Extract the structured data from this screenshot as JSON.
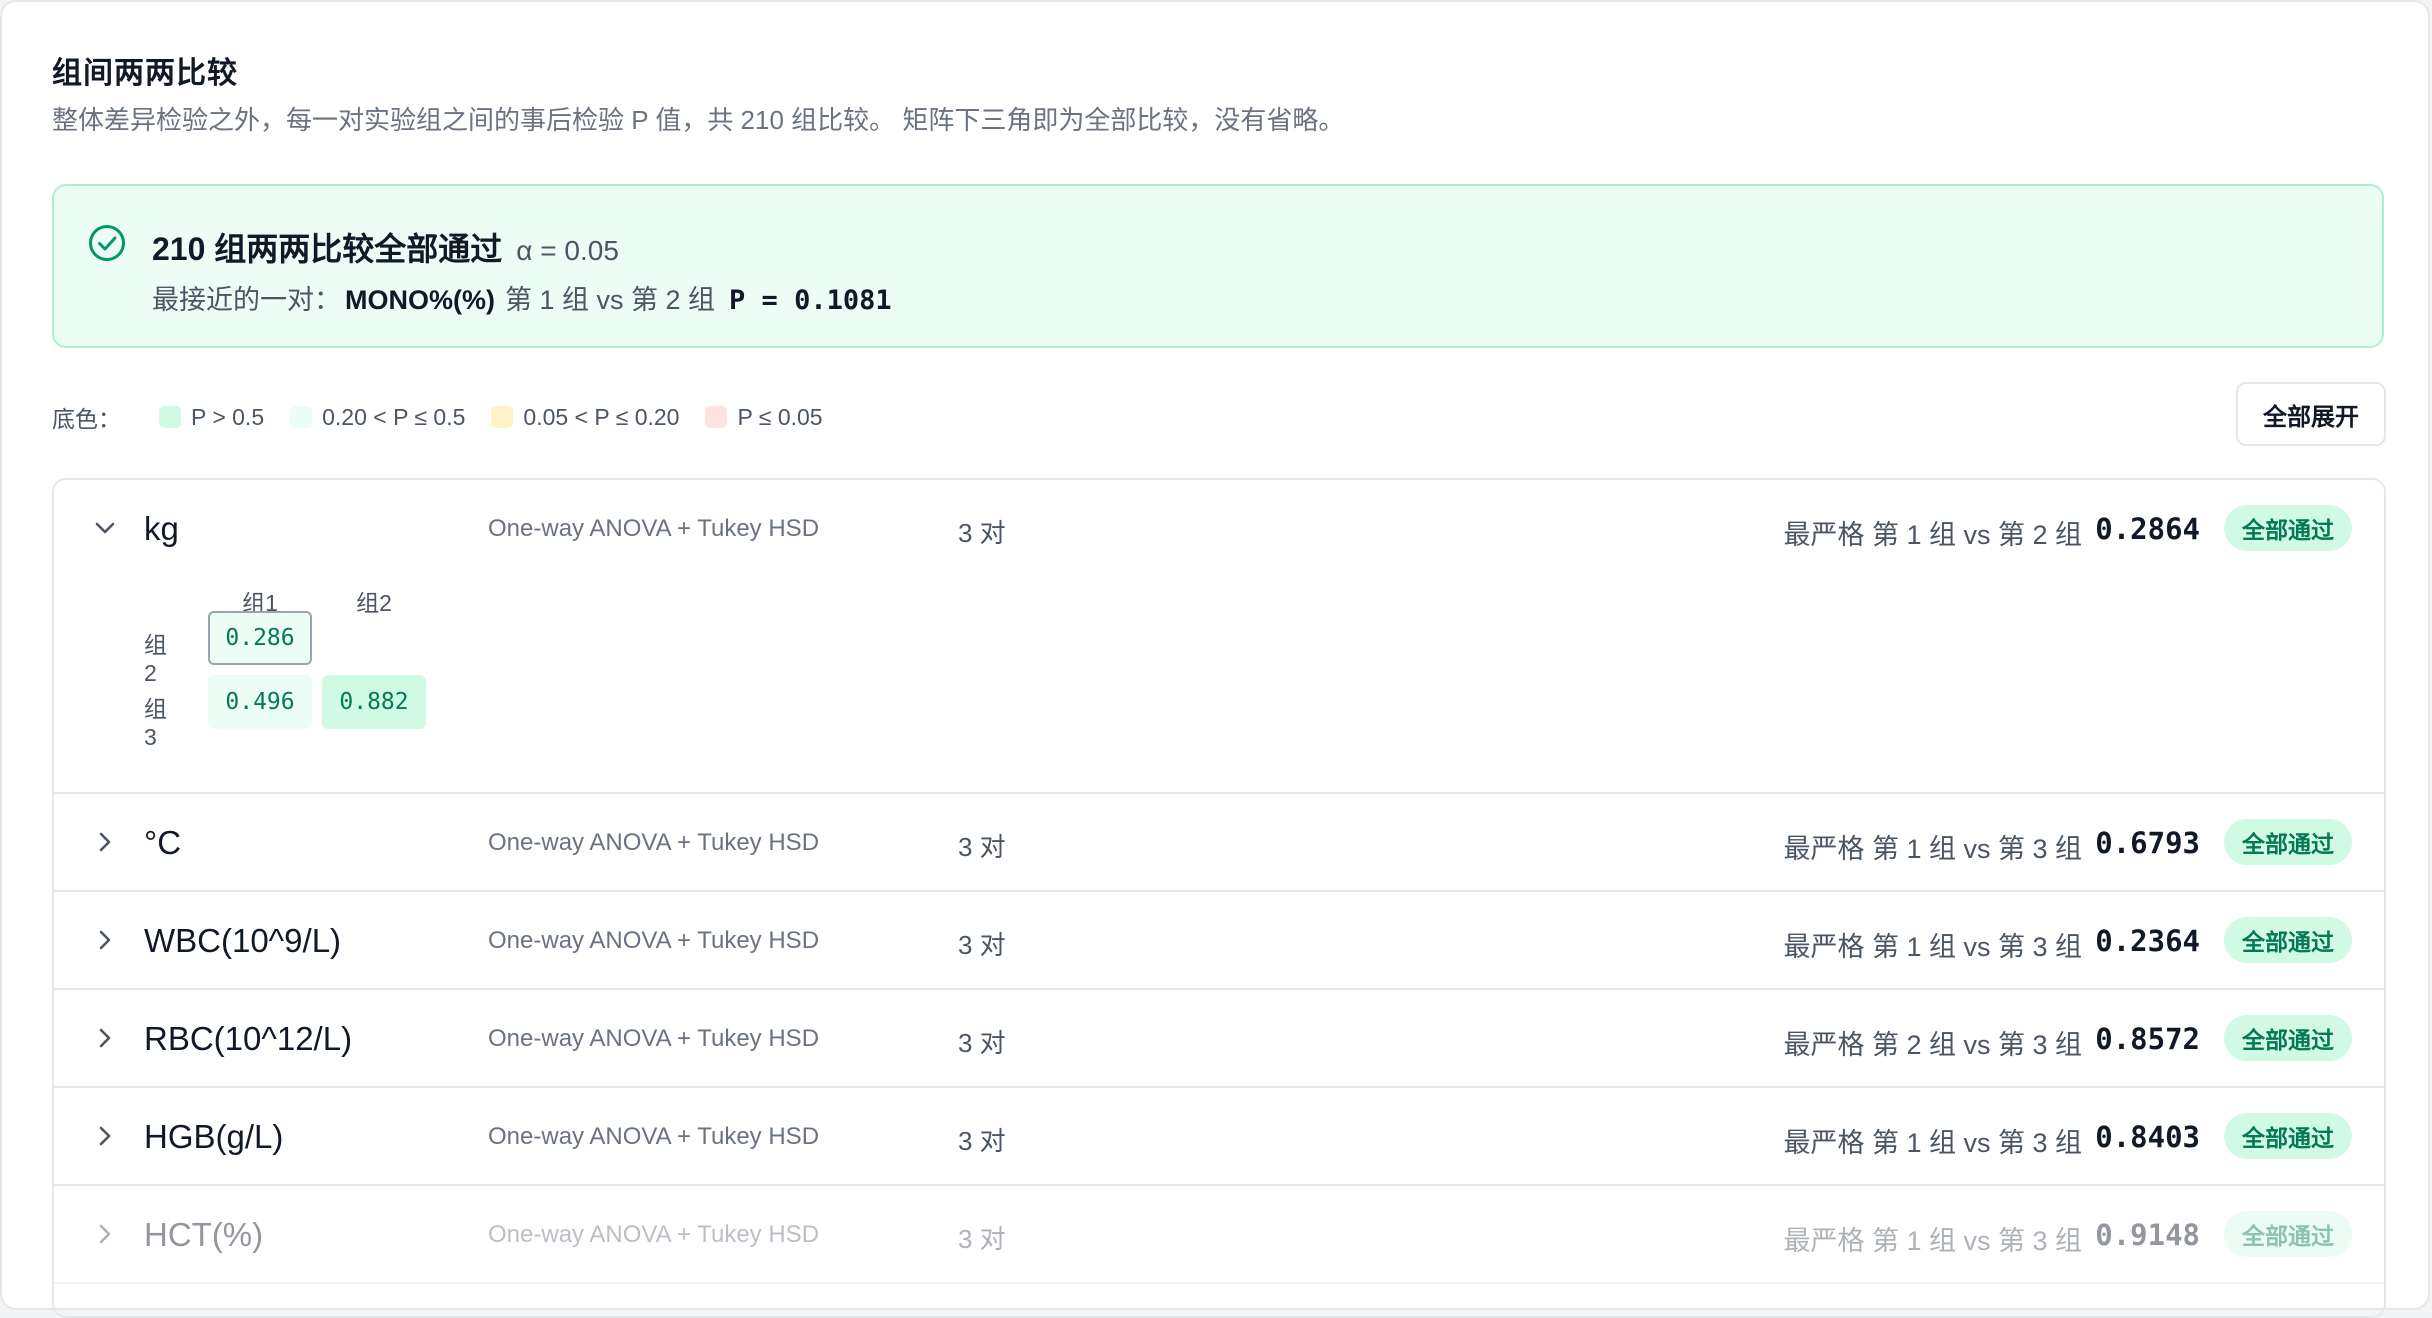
{
  "section": {
    "title": "组间两两比较",
    "description": "整体差异检验之外，每一对实验组之间的事后检验 P 值，共 210 组比较。 矩阵下三角即为全部比较，没有省略。"
  },
  "alert": {
    "title": "210 组两两比较全部通过",
    "alpha": "α = 0.05",
    "closest_label": "最接近的一对：",
    "closest_metric": "MONO%(%)",
    "closest_pair": "第 1 组 vs 第 2 组",
    "closest_p": "P = 0.1081",
    "icon": "check-circle-icon"
  },
  "legend": {
    "label": "底色：",
    "items": [
      {
        "text": "P > 0.5",
        "color": "#d1fae5"
      },
      {
        "text": "0.20 < P ≤ 0.5",
        "color": "#ecfdf5"
      },
      {
        "text": "0.05 < P ≤ 0.20",
        "color": "#fef3c7"
      },
      {
        "text": "P ≤ 0.05",
        "color": "#fee2e2"
      }
    ]
  },
  "expand_all_label": "全部展开",
  "rows": [
    {
      "name": "kg",
      "method": "One-way ANOVA + Tukey HSD",
      "pairs": "3 对",
      "strict": "最严格 第 1 组 vs 第 2 组",
      "p": "0.2864",
      "badge": "全部通过",
      "expanded": true,
      "matrix": {
        "cols": [
          "组1",
          "组2"
        ],
        "rows": [
          {
            "label": "组2",
            "cells": [
              "0.286"
            ]
          },
          {
            "label": "组3",
            "cells": [
              "0.496",
              "0.882"
            ]
          }
        ]
      }
    },
    {
      "name": "°C",
      "method": "One-way ANOVA + Tukey HSD",
      "pairs": "3 对",
      "strict": "最严格 第 1 组 vs 第 3 组",
      "p": "0.6793",
      "badge": "全部通过"
    },
    {
      "name": "WBC(10^9/L)",
      "method": "One-way ANOVA + Tukey HSD",
      "pairs": "3 对",
      "strict": "最严格 第 1 组 vs 第 3 组",
      "p": "0.2364",
      "badge": "全部通过"
    },
    {
      "name": "RBC(10^12/L)",
      "method": "One-way ANOVA + Tukey HSD",
      "pairs": "3 对",
      "strict": "最严格 第 2 组 vs 第 3 组",
      "p": "0.8572",
      "badge": "全部通过"
    },
    {
      "name": "HGB(g/L)",
      "method": "One-way ANOVA + Tukey HSD",
      "pairs": "3 对",
      "strict": "最严格 第 1 组 vs 第 3 组",
      "p": "0.8403",
      "badge": "全部通过"
    },
    {
      "name": "HCT(%)",
      "method": "One-way ANOVA + Tukey HSD",
      "pairs": "3 对",
      "strict": "最严格 第 1 组 vs 第 3 组",
      "p": "0.9148",
      "badge": "全部通过"
    }
  ]
}
